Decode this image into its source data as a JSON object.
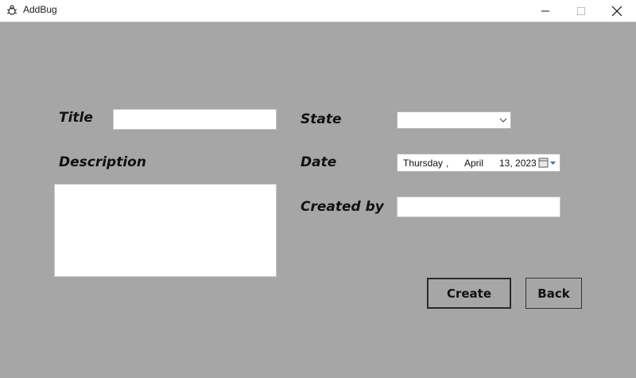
{
  "window": {
    "title": "AddBug"
  },
  "form": {
    "title_label": "Title",
    "title_value": "",
    "description_label": "Description",
    "description_value": "",
    "state_label": "State",
    "state_value": "",
    "date_label": "Date",
    "date_parts": {
      "weekday": "Thursday",
      "sep": ",",
      "month": "April",
      "day_year": "13, 2023"
    },
    "created_by_label": "Created by",
    "created_by_value": ""
  },
  "buttons": {
    "create": "Create",
    "back": "Back"
  },
  "icons": {
    "app": "bug-icon",
    "dropdown": "chevron-down-icon",
    "calendar": "calendar-icon"
  }
}
